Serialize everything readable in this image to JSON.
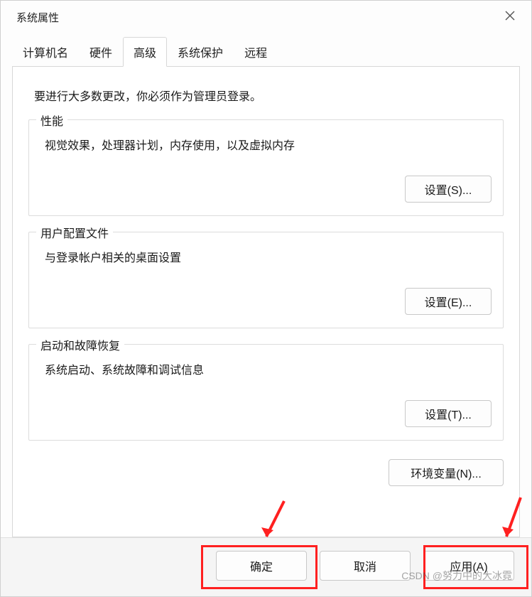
{
  "title": "系统属性",
  "tabs": {
    "computer_name": "计算机名",
    "hardware": "硬件",
    "advanced": "高级",
    "system_protection": "系统保护",
    "remote": "远程"
  },
  "advanced_panel": {
    "admin_notice": "要进行大多数更改，你必须作为管理员登录。",
    "performance": {
      "legend": "性能",
      "desc": "视觉效果，处理器计划，内存使用，以及虚拟内存",
      "settings_btn": "设置(S)..."
    },
    "user_profiles": {
      "legend": "用户配置文件",
      "desc": "与登录帐户相关的桌面设置",
      "settings_btn": "设置(E)..."
    },
    "startup_recovery": {
      "legend": "启动和故障恢复",
      "desc": "系统启动、系统故障和调试信息",
      "settings_btn": "设置(T)..."
    },
    "env_vars_btn": "环境变量(N)..."
  },
  "footer": {
    "ok": "确定",
    "cancel": "取消",
    "apply": "应用(A)"
  },
  "watermark": "CSDN @努力中的大冰霓"
}
